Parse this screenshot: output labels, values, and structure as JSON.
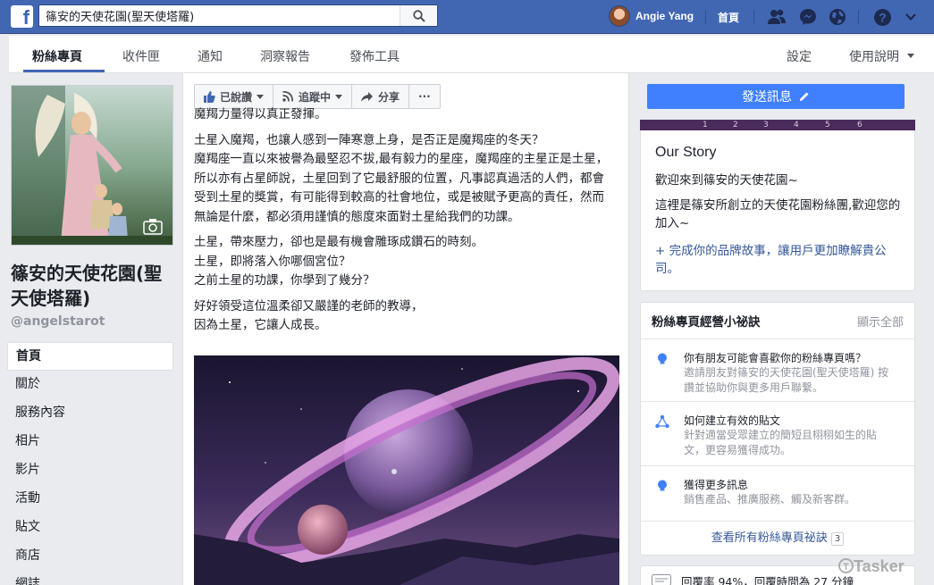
{
  "topbar": {
    "logo_letter": "f",
    "search_value": "篠安的天使花園(聖天使塔羅)",
    "user_name": "Angie Yang",
    "home_label": "首頁",
    "icons": [
      "friends-icon",
      "messenger-icon",
      "globe-icon",
      "help-icon",
      "caret-down-icon"
    ]
  },
  "pagenav": {
    "tabs": [
      {
        "label": "粉絲專頁"
      },
      {
        "label": "收件匣"
      },
      {
        "label": "通知"
      },
      {
        "label": "洞察報告"
      },
      {
        "label": "發佈工具"
      }
    ],
    "settings_label": "設定",
    "help_label": "使用說明"
  },
  "left": {
    "page_name": "篠安的天使花園(聖天使塔羅)",
    "handle": "@angelstarot",
    "nav": [
      {
        "label": "首頁"
      },
      {
        "label": "關於"
      },
      {
        "label": "服務內容"
      },
      {
        "label": "相片"
      },
      {
        "label": "影片"
      },
      {
        "label": "活動"
      },
      {
        "label": "貼文"
      },
      {
        "label": "商店"
      },
      {
        "label": "網誌"
      }
    ]
  },
  "actionbar": {
    "liked_label": "已說讚",
    "following_label": "追蹤中",
    "share_label": "分享",
    "more_label": "···"
  },
  "post": {
    "line0": "魔羯力量得以真正發揮。",
    "para1": "土星入魔羯，也讓人感到一陣寒意上身，是否正是魔羯座的冬天？\n魔羯座一直以來被譽為最堅忍不拔,最有毅力的星座，魔羯座的主星正是土星，所以亦有占星師說，土星回到了它最舒服的位置，凡事認真過活的人們，都會受到土星的獎賞，有可能得到較高的社會地位，或是被賦予更高的責任，然而無論是什麼，都必須用謹慎的態度來面對土星給我們的功課。",
    "para2": "土星，帶來壓力，卻也是最有機會雕琢成鑽石的時刻。\n土星，即將落入你哪個宮位？\n之前土星的功課，你學到了幾分？",
    "para3": "好好領受這位溫柔卻又嚴謹的老師的教導，\n因為土星，它讓人成長。"
  },
  "right": {
    "send_message_label": "發送訊息",
    "strip_numbers": [
      "1",
      "2",
      "3",
      "4",
      "5",
      "6"
    ],
    "story": {
      "title": "Our Story",
      "welcome": "歡迎來到篠安的天使花園~",
      "desc": "這裡是篠安所創立的天使花園粉絲團,歡迎您的加入~",
      "link": "+ 完成你的品牌故事，讓用戶更加瞭解貴公司。"
    },
    "tips": {
      "title": "粉絲專頁經營小祕訣",
      "hide_label": "顯示全部",
      "items": [
        {
          "title": "你有朋友可能會喜歡你的粉絲專頁嗎？",
          "desc": "邀請朋友對篠安的天使花園(聖天使塔羅) 按讚並協助你與更多用戶聯繫。",
          "icon": "lightbulb-icon"
        },
        {
          "title": "如何建立有效的貼文",
          "desc": "針對適當受眾建立的簡短且栩栩如生的貼文，更容易獲得成功。",
          "icon": "share-nodes-icon"
        },
        {
          "title": "獲得更多訊息",
          "desc": "銷售產品、推廣服務、觸及新客群。",
          "icon": "lightbulb-icon"
        }
      ],
      "footer_label": "查看所有粉絲專頁祕訣",
      "footer_count": "3"
    },
    "response": {
      "text": "回覆率 94%，回覆時間為 27 分鐘"
    }
  },
  "watermark": "Tasker",
  "colors": {
    "brand_blue": "#4267b2",
    "send_button": "#4080ff",
    "link_blue": "#365899",
    "tip_icon": "#4080ff"
  }
}
